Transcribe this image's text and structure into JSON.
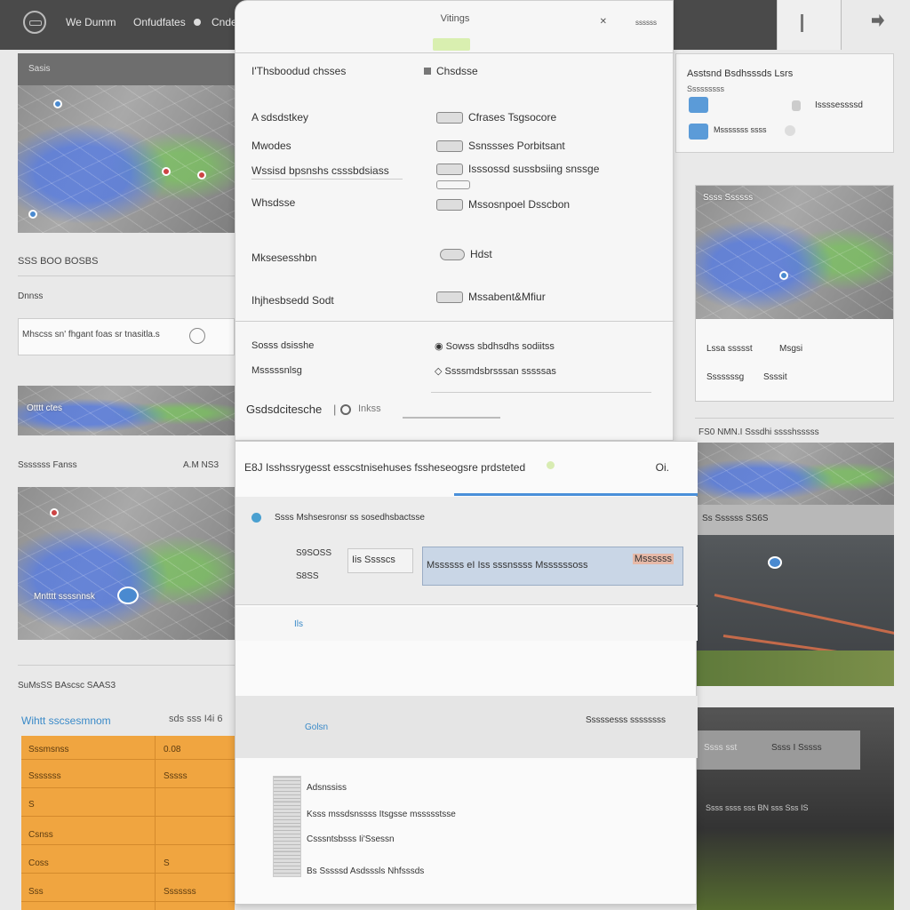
{
  "topbar": {
    "nav": [
      "We Dumm",
      "Onfudfates",
      "Cnde"
    ]
  },
  "left": {
    "map_header": "Sasis",
    "section1": "SSS BOO BOSBS",
    "section2": "Dnnss",
    "search_text": "Mhscss sn' fhgant foas sr tnasitla.s",
    "map2_label": "Otttt ctes",
    "section3_left": "Sssssss Fanss",
    "section3_right": "A.M NS3",
    "map3_label": "Mntttt ssssnnsk",
    "section4": "SuMsSS BAscsc SAAS3",
    "link_text": "Wihtt sscsesmnom",
    "link_right": "sds sss  I4i 6",
    "table_rows": [
      {
        "a": "Sssmsnss",
        "b": "0.08"
      },
      {
        "a": "Sssssss",
        "b": "Sssss"
      },
      {
        "a": "S",
        "b": ""
      },
      {
        "a": "Csnss",
        "b": ""
      },
      {
        "a": "Coss",
        "b": "S"
      },
      {
        "a": "Sss",
        "b": "Sssssss"
      }
    ]
  },
  "panel": {
    "title": "Vitings",
    "close": "ssssss",
    "col1_header": "I'Thsboodud chsses",
    "col2_header": "Chsdsse",
    "rows_left": [
      "A sdsdstkey",
      "Mwodes",
      "Wssisd bpsnshs csssbdsiass",
      "Whsdsse",
      "Mksesesshbn",
      "Ihjhesbsedd Sodt"
    ],
    "rows_right": [
      "Cfrases Tsgsocore",
      "Ssnssses Porbitsant",
      "Isssossd sussbsiing snssge",
      "Mssosnpoel Dsscbon",
      "Hdst",
      "Mssabent&Mfiur"
    ],
    "rows2_left": [
      "Sosss dsisshe",
      "Msssssnlsg"
    ],
    "rows2_right": [
      "Sowss sbdhsdhs sodiitss",
      "Ssssmdsbrsssan sssssas"
    ],
    "field_label": "Gsdsdcitesche",
    "field_value": "Inkss"
  },
  "dialog": {
    "title": "E8J Isshssrygesst esscstnisehuses fssheseogsre prdsteted",
    "ok": "Oi.",
    "option": "Ssss Mshsesronsr ss sosedhsbactsse",
    "label1": "S9SOSS",
    "label2": "S8SS",
    "input_short": "Iis Sssscs",
    "input_long": "Mssssss eI   Iss sssnssss Mssssssoss",
    "input_long_sel": "Mssssss",
    "sub_label": "Ils",
    "section3_left": "Golsn",
    "section3_right": "Sssssesss ssssssss",
    "list": [
      "Adsnssiss",
      "Ksss mssdsnssss Itsgsse mssssstsse",
      "Csssntsbsss Ii'Ssessn",
      "Bs Sssssd Asdsssls Nhfsssds"
    ]
  },
  "right": {
    "card_title": "Asstsnd Bsdhsssds Lsrs",
    "card_sub": "Sssssssss",
    "item1": "Issssessssd",
    "item2": "Msssssss ssss",
    "map_title": "Ssss Ssssss",
    "map_caption_l": "Lssa ssssst",
    "map_caption_r": "Msgsi",
    "map_caption2_l": "Sssssssg",
    "map_caption2_r": "Ssssit",
    "section_title": "FS0 NMN.I Sssdhi sssshsssss",
    "photo1_label": "Ss Ssssss SS6S",
    "photo2_label": "Ssss sst",
    "photo2_label2": "Ssss I Sssss",
    "photo2_caption": "Ssss ssss  sss BN   sss   Sss IS"
  }
}
